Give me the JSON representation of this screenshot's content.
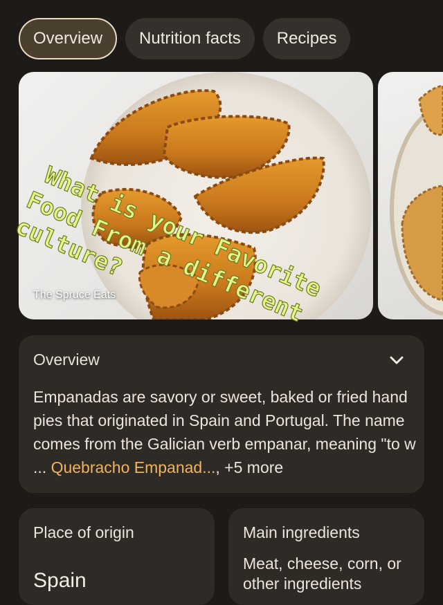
{
  "tabs": [
    {
      "label": "Overview",
      "active": true
    },
    {
      "label": "Nutrition facts",
      "active": false
    },
    {
      "label": "Recipes",
      "active": false
    }
  ],
  "image": {
    "source": "The Spruce Eats",
    "overlay_lines": [
      "What is your Favorite",
      "Food From a different",
      "culture?"
    ]
  },
  "overview": {
    "title": "Overview",
    "text": "Empanadas are savory or sweet, baked or fried hand pies that originated in Spain and Portugal. The name comes from the Galician verb empanar, meaning \"to w ...",
    "link": "Quebracho Empanad...",
    "more": ", +5 more"
  },
  "origin": {
    "title": "Place of origin",
    "value": "Spain"
  },
  "ingredients": {
    "title": "Main ingredients",
    "value": "Meat, cheese, corn, or other ingredients"
  },
  "colors": {
    "background": "#1d1a17",
    "card": "#2e2a26",
    "link": "#f0b35e",
    "overlay_text": "#e3f58a"
  }
}
